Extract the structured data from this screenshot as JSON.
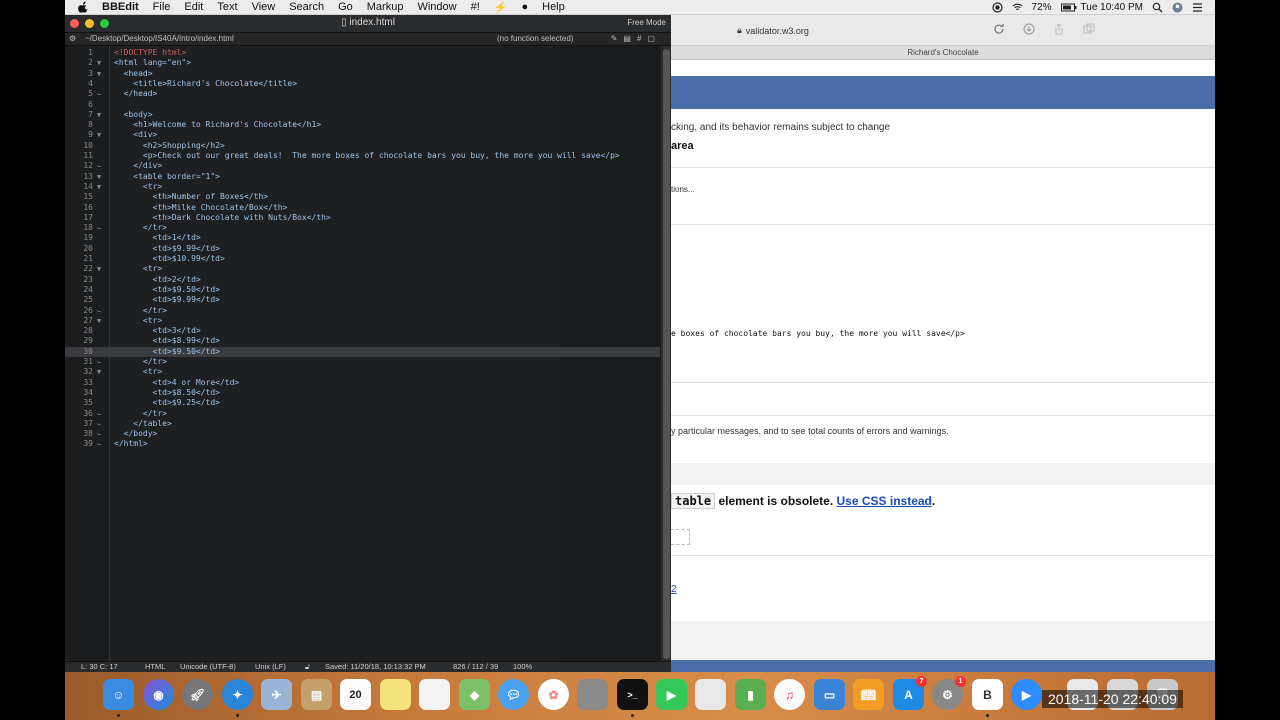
{
  "menubar": {
    "app": "BBEdit",
    "items": [
      "File",
      "Edit",
      "Text",
      "View",
      "Search",
      "Go",
      "Markup",
      "Window",
      "#!",
      "Help"
    ],
    "battery": "72%",
    "clock": "Tue 10:40 PM"
  },
  "editor": {
    "file_name": "index.html",
    "mode": "Free Mode",
    "path": "~/Desktop/Desktop/IS40A/Intro/index.html",
    "function_menu": "(no function selected)",
    "lines": [
      {
        "n": "1",
        "fold": "",
        "code": "<!DOCTYPE html>",
        "kind": "doc"
      },
      {
        "n": "2",
        "fold": "▼",
        "code": "<html lang=\"en\">",
        "kind": "tag"
      },
      {
        "n": "3",
        "fold": "▼",
        "code": "  <head>",
        "kind": "tag"
      },
      {
        "n": "4",
        "fold": "",
        "code": "    <title>Richard's Chocolate</title>",
        "kind": "tag"
      },
      {
        "n": "5",
        "fold": "⌙",
        "code": "  </head>",
        "kind": "tag"
      },
      {
        "n": "6",
        "fold": "",
        "code": "",
        "kind": "tag"
      },
      {
        "n": "7",
        "fold": "▼",
        "code": "  <body>",
        "kind": "tag"
      },
      {
        "n": "8",
        "fold": "",
        "code": "    <h1>Welcome to Richard's Chocolate</h1>",
        "kind": "tag"
      },
      {
        "n": "9",
        "fold": "▼",
        "code": "    <div>",
        "kind": "tag"
      },
      {
        "n": "10",
        "fold": "",
        "code": "      <h2>Shopping</h2>",
        "kind": "tag"
      },
      {
        "n": "11",
        "fold": "",
        "code": "      <p>Check out our great deals!  The more boxes of chocolate bars you buy, the more you will save</p>",
        "kind": "tag"
      },
      {
        "n": "12",
        "fold": "⌙",
        "code": "    </div>",
        "kind": "tag"
      },
      {
        "n": "13",
        "fold": "▼",
        "code": "    <table border=\"1\">",
        "kind": "tag"
      },
      {
        "n": "14",
        "fold": "▼",
        "code": "      <tr>",
        "kind": "tag"
      },
      {
        "n": "15",
        "fold": "",
        "code": "        <th>Number of Boxes</th>",
        "kind": "tag"
      },
      {
        "n": "16",
        "fold": "",
        "code": "        <th>Milke Chocolate/Box</th>",
        "kind": "tag"
      },
      {
        "n": "17",
        "fold": "",
        "code": "        <th>Dark Chocolate with Nuts/Box</th>",
        "kind": "tag"
      },
      {
        "n": "18",
        "fold": "⌙",
        "code": "      </tr>",
        "kind": "tag"
      },
      {
        "n": "19",
        "fold": "",
        "code": "        <td>1</td>",
        "kind": "tag"
      },
      {
        "n": "20",
        "fold": "",
        "code": "        <td>$9.99</td>",
        "kind": "tag"
      },
      {
        "n": "21",
        "fold": "",
        "code": "        <td>$10.99</td>",
        "kind": "tag"
      },
      {
        "n": "22",
        "fold": "▼",
        "code": "      <tr>",
        "kind": "tag"
      },
      {
        "n": "23",
        "fold": "",
        "code": "        <td>2</td>",
        "kind": "tag"
      },
      {
        "n": "24",
        "fold": "",
        "code": "        <td>$9.50</td>",
        "kind": "tag"
      },
      {
        "n": "25",
        "fold": "",
        "code": "        <td>$9.99</td>",
        "kind": "tag"
      },
      {
        "n": "26",
        "fold": "⌙",
        "code": "      </tr>",
        "kind": "tag"
      },
      {
        "n": "27",
        "fold": "▼",
        "code": "      <tr>",
        "kind": "tag"
      },
      {
        "n": "28",
        "fold": "",
        "code": "        <td>3</td>",
        "kind": "tag"
      },
      {
        "n": "29",
        "fold": "",
        "code": "        <td>$8.99</td>",
        "kind": "tag"
      },
      {
        "n": "30",
        "fold": "",
        "code": "        <td>$9.50</td>",
        "kind": "tag"
      },
      {
        "n": "31",
        "fold": "⌙",
        "code": "      </tr>",
        "kind": "tag"
      },
      {
        "n": "32",
        "fold": "▼",
        "code": "      <tr>",
        "kind": "tag"
      },
      {
        "n": "33",
        "fold": "",
        "code": "        <td>4 or More</td>",
        "kind": "tag"
      },
      {
        "n": "34",
        "fold": "",
        "code": "        <td>$8.50</td>",
        "kind": "tag"
      },
      {
        "n": "35",
        "fold": "",
        "code": "        <td>$9.25</td>",
        "kind": "tag"
      },
      {
        "n": "36",
        "fold": "⌙",
        "code": "      </tr>",
        "kind": "tag"
      },
      {
        "n": "37",
        "fold": "⌙",
        "code": "    </table>",
        "kind": "tag"
      },
      {
        "n": "38",
        "fold": "⌙",
        "code": "  </body>",
        "kind": "tag"
      },
      {
        "n": "39",
        "fold": "⌙",
        "code": "</html>",
        "kind": "tag"
      }
    ],
    "current_line": 30,
    "status": {
      "position": "L: 30 C: 17",
      "language": "HTML",
      "encoding": "Unicode (UTF-8)",
      "line_endings": "Unix (LF)",
      "saved": "Saved: 11/20/18, 10:13:32 PM",
      "counts": "826 / 112 / 39",
      "zoom": "100%"
    }
  },
  "browser": {
    "url": "validator.w3.org",
    "tab_title": "Richard's Chocolate",
    "notice": "cking, and its behavior remains subject to change",
    "heading": "area",
    "options": "tions...",
    "code_snippet": "e boxes of chocolate bars you buy, the more you will save</p>",
    "filter_text": "y particular messages, and to see total counts of errors and warnings.",
    "error_attr": "table",
    "error_text": " element is obsolete. ",
    "error_link": "Use CSS instead",
    "error_end": ".",
    "footer_link": "2"
  },
  "dock": {
    "calendar_day": "20",
    "badge_appstore": "7",
    "badge_prefs": "1"
  },
  "timestamp": "2018-11-20 22:40:09"
}
